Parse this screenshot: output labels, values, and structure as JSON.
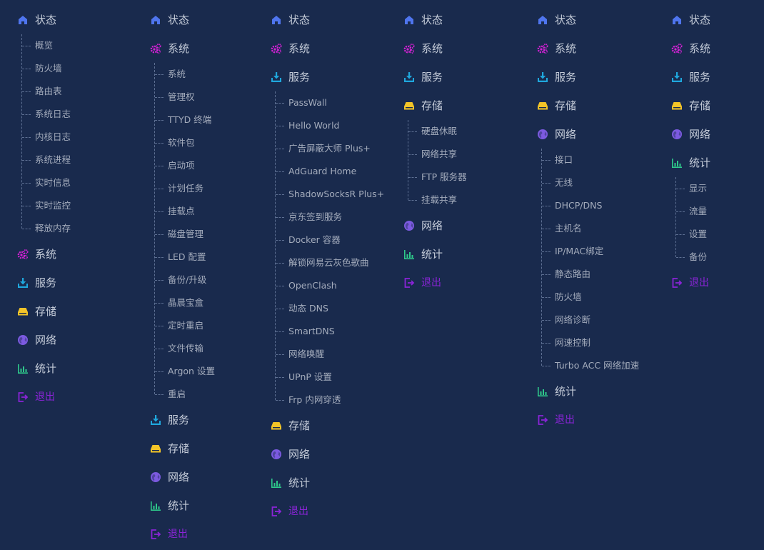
{
  "colors": {
    "background": "#192a4d",
    "status_icon": "#4f75ee",
    "system_icon": "#d422d6",
    "service_icon": "#1fa7dd",
    "storage_icon": "#f3c428",
    "network_icon": "#7c5ae0",
    "stats_icon": "#2ec98b",
    "logout": "#8b24d8"
  },
  "menus": [
    {
      "items": [
        {
          "label": "状态",
          "icon": "home-icon",
          "kind": "status",
          "children": [
            "概览",
            "防火墙",
            "路由表",
            "系统日志",
            "内核日志",
            "系统进程",
            "实时信息",
            "实时监控",
            "释放内存"
          ]
        },
        {
          "label": "系统",
          "icon": "gears-icon",
          "kind": "system"
        },
        {
          "label": "服务",
          "icon": "download-tray-icon",
          "kind": "service"
        },
        {
          "label": "存储",
          "icon": "drive-icon",
          "kind": "storage"
        },
        {
          "label": "网络",
          "icon": "globe-icon",
          "kind": "network"
        },
        {
          "label": "统计",
          "icon": "bar-chart-icon",
          "kind": "stats"
        },
        {
          "label": "退出",
          "icon": "logout-icon",
          "kind": "logout"
        }
      ]
    },
    {
      "items": [
        {
          "label": "状态",
          "icon": "home-icon",
          "kind": "status"
        },
        {
          "label": "系统",
          "icon": "gears-icon",
          "kind": "system",
          "children": [
            "系统",
            "管理权",
            "TTYD 终端",
            "软件包",
            "启动项",
            "计划任务",
            "挂载点",
            "磁盘管理",
            "LED 配置",
            "备份/升级",
            "晶晨宝盒",
            "定时重启",
            "文件传输",
            "Argon 设置",
            "重启"
          ]
        },
        {
          "label": "服务",
          "icon": "download-tray-icon",
          "kind": "service"
        },
        {
          "label": "存储",
          "icon": "drive-icon",
          "kind": "storage"
        },
        {
          "label": "网络",
          "icon": "globe-icon",
          "kind": "network"
        },
        {
          "label": "统计",
          "icon": "bar-chart-icon",
          "kind": "stats"
        },
        {
          "label": "退出",
          "icon": "logout-icon",
          "kind": "logout"
        }
      ]
    },
    {
      "items": [
        {
          "label": "状态",
          "icon": "home-icon",
          "kind": "status"
        },
        {
          "label": "系统",
          "icon": "gears-icon",
          "kind": "system"
        },
        {
          "label": "服务",
          "icon": "download-tray-icon",
          "kind": "service",
          "children": [
            "PassWall",
            "Hello World",
            "广告屏蔽大师 Plus+",
            "AdGuard Home",
            "ShadowSocksR Plus+",
            "京东签到服务",
            "Docker 容器",
            "解锁网易云灰色歌曲",
            "OpenClash",
            "动态 DNS",
            "SmartDNS",
            "网络唤醒",
            "UPnP 设置",
            "Frp 内网穿透"
          ]
        },
        {
          "label": "存储",
          "icon": "drive-icon",
          "kind": "storage"
        },
        {
          "label": "网络",
          "icon": "globe-icon",
          "kind": "network"
        },
        {
          "label": "统计",
          "icon": "bar-chart-icon",
          "kind": "stats"
        },
        {
          "label": "退出",
          "icon": "logout-icon",
          "kind": "logout"
        }
      ]
    },
    {
      "items": [
        {
          "label": "状态",
          "icon": "home-icon",
          "kind": "status"
        },
        {
          "label": "系统",
          "icon": "gears-icon",
          "kind": "system"
        },
        {
          "label": "服务",
          "icon": "download-tray-icon",
          "kind": "service"
        },
        {
          "label": "存储",
          "icon": "drive-icon",
          "kind": "storage",
          "children": [
            "硬盘休眠",
            "网络共享",
            "FTP 服务器",
            "挂载共享"
          ]
        },
        {
          "label": "网络",
          "icon": "globe-icon",
          "kind": "network"
        },
        {
          "label": "统计",
          "icon": "bar-chart-icon",
          "kind": "stats"
        },
        {
          "label": "退出",
          "icon": "logout-icon",
          "kind": "logout"
        }
      ]
    },
    {
      "items": [
        {
          "label": "状态",
          "icon": "home-icon",
          "kind": "status"
        },
        {
          "label": "系统",
          "icon": "gears-icon",
          "kind": "system"
        },
        {
          "label": "服务",
          "icon": "download-tray-icon",
          "kind": "service"
        },
        {
          "label": "存储",
          "icon": "drive-icon",
          "kind": "storage"
        },
        {
          "label": "网络",
          "icon": "globe-icon",
          "kind": "network",
          "children": [
            "接口",
            "无线",
            "DHCP/DNS",
            "主机名",
            "IP/MAC绑定",
            "静态路由",
            "防火墙",
            "网络诊断",
            "网速控制",
            "Turbo ACC 网络加速"
          ]
        },
        {
          "label": "统计",
          "icon": "bar-chart-icon",
          "kind": "stats"
        },
        {
          "label": "退出",
          "icon": "logout-icon",
          "kind": "logout"
        }
      ]
    },
    {
      "items": [
        {
          "label": "状态",
          "icon": "home-icon",
          "kind": "status"
        },
        {
          "label": "系统",
          "icon": "gears-icon",
          "kind": "system"
        },
        {
          "label": "服务",
          "icon": "download-tray-icon",
          "kind": "service"
        },
        {
          "label": "存储",
          "icon": "drive-icon",
          "kind": "storage"
        },
        {
          "label": "网络",
          "icon": "globe-icon",
          "kind": "network"
        },
        {
          "label": "统计",
          "icon": "bar-chart-icon",
          "kind": "stats",
          "children": [
            "显示",
            "流量",
            "设置",
            "备份"
          ]
        },
        {
          "label": "退出",
          "icon": "logout-icon",
          "kind": "logout"
        }
      ]
    }
  ]
}
